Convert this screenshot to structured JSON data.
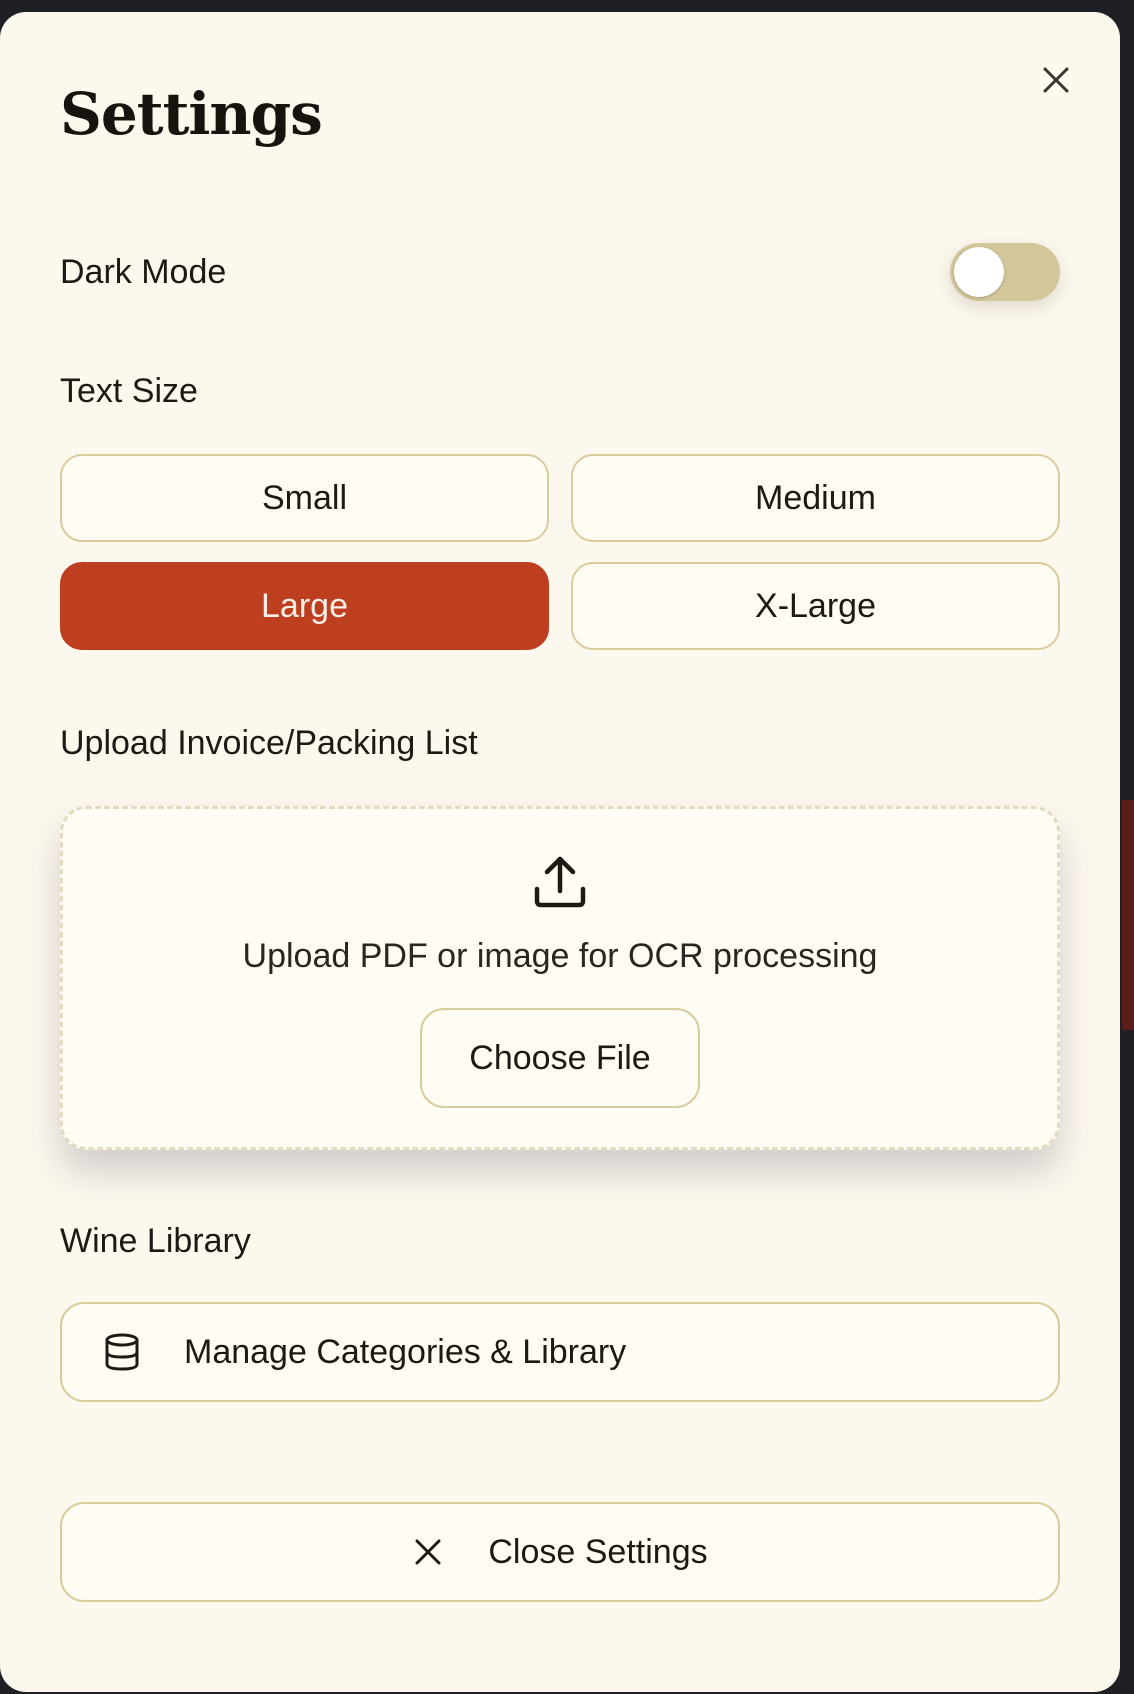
{
  "modal": {
    "title": "Settings",
    "close_icon": "close-icon"
  },
  "dark_mode": {
    "label": "Dark Mode",
    "enabled": false
  },
  "text_size": {
    "label": "Text Size",
    "options": [
      "Small",
      "Medium",
      "Large",
      "X-Large"
    ],
    "selected": "Large"
  },
  "upload": {
    "label": "Upload Invoice/Packing List",
    "icon": "upload-icon",
    "description": "Upload PDF or image for OCR processing",
    "button_label": "Choose File"
  },
  "library": {
    "label": "Wine Library",
    "icon": "database-icon",
    "button_label": "Manage Categories & Library"
  },
  "footer": {
    "icon": "close-icon",
    "close_label": "Close Settings"
  },
  "colors": {
    "background": "#fdf8ee",
    "accent": "#bd3f1f",
    "border": "#d8cc9c",
    "toggle_track": "#d2c69b"
  }
}
